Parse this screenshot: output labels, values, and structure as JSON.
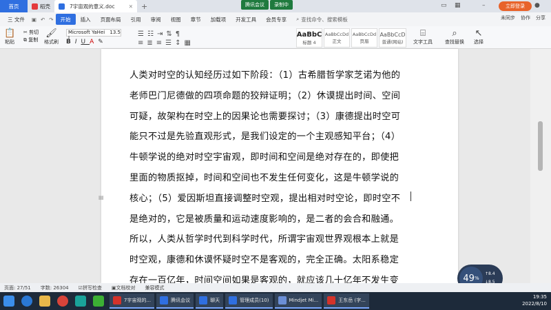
{
  "titlebar": {
    "home_tab": "首页",
    "tab2": "稻壳",
    "doc_tab": "7宇宙观的意义.doc",
    "meet_a": "腾讯会议",
    "meet_b": "录制中",
    "login": "立即登录"
  },
  "menubar": {
    "file": "三 文件",
    "items": [
      "开始",
      "插入",
      "页面布局",
      "引用",
      "审阅",
      "视图",
      "章节",
      "加载项",
      "开发工具",
      "会员专享"
    ],
    "search": "查找命令、搜索模板",
    "right": [
      "未同步",
      "协作",
      "分享"
    ]
  },
  "ribbon": {
    "paste": "粘贴",
    "cut": "剪切",
    "copy": "复制",
    "format_brush": "格式刷",
    "font_name": "Microsoft YaHei I",
    "font_size": "13.5",
    "styles": [
      {
        "sample": "AaBbC",
        "label": "标题 4"
      },
      {
        "sample": "AaBbCcDd",
        "label": "正文"
      },
      {
        "sample": "AaBbCcDd",
        "label": "页眉"
      },
      {
        "sample": "AaBbCcD",
        "label": "普通(网站)"
      }
    ],
    "text_tools": "文字工具",
    "find_replace": "查找替换",
    "select": "选择"
  },
  "document": {
    "lines": [
      "人类对时空的认知经历过如下阶段：（1）古希腊哲学家芝诺为他的",
      "老师巴门尼德做的四项命题的狡辩证明；（2）休谟提出时间、空间",
      "可疑，故架构在时空上的因果论也需要探讨；（3）康德提出时空可",
      "能只不过是先验直观形式，是我们设定的一个主观感知平台；（4）",
      "牛顿学说的绝对时空宇宙观，即时间和空间是绝对存在的，即使把",
      "里面的物质抠掉，时间和空间也不发生任何变化，这是牛顿学说的",
      "核心；（5）爱因斯坦直接调整时空观，提出相对时空论，即时空不",
      "是绝对的，它是被质量和运动速度影响的，是二者的会合和融通。",
      "所以，人类从哲学时代到科学时代，所谓宇宙观世界观根本上就是",
      "时空观，康德和休谟怀疑时空不是客观的，完全正确。太阳系稳定",
      "存在一百亿年，时间空间如果是客观的，就应该几十亿年不发生变"
    ]
  },
  "zoom_widget": {
    "percent": "49",
    "unit": "%",
    "up": "8.4",
    "down": "8.5"
  },
  "statusbar": {
    "page": "页面: 27/51",
    "words": "字数: 26304",
    "spell": "拼写检查",
    "proof": "文档校对",
    "compat": "兼容模式"
  },
  "taskbar": {
    "apps": [
      "7宇宙观的...",
      "腾讯会议",
      "聊天",
      "管理成员(10)",
      "Mindjet Mi...",
      "王东岳 (字..."
    ],
    "time": "19:35",
    "date": "2022/8/10"
  }
}
